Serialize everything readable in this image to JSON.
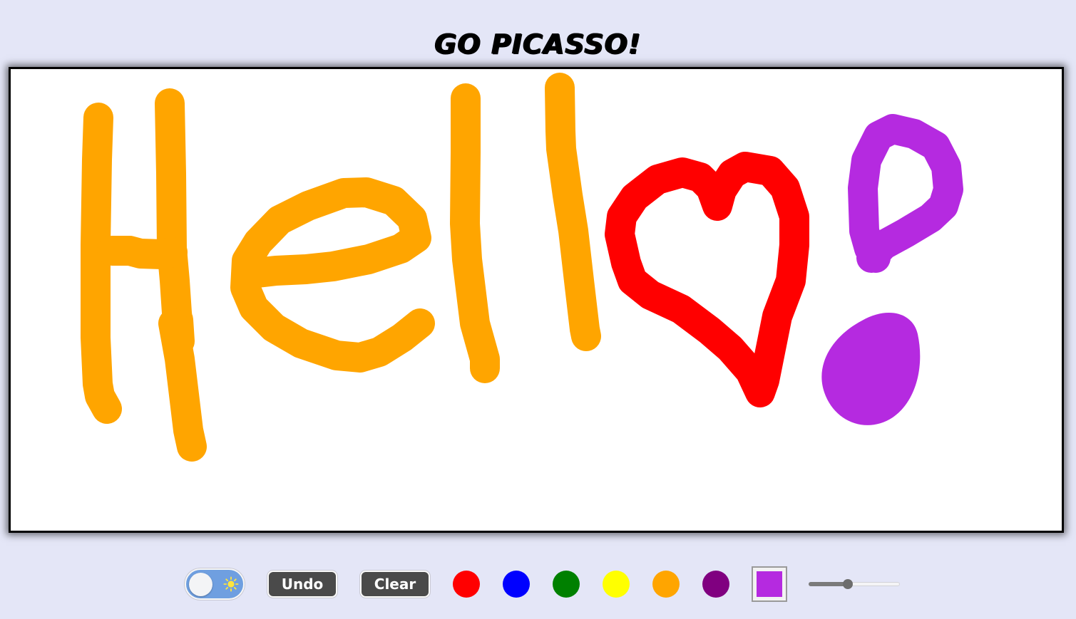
{
  "app": {
    "title": "GO PICASSO!"
  },
  "canvas": {
    "background": "#ffffff",
    "drawing_text": "Hello!",
    "strokes": [
      {
        "color": "#ffa500",
        "shape": "letter-H"
      },
      {
        "color": "#ffa500",
        "shape": "letter-e"
      },
      {
        "color": "#ffa500",
        "shape": "letter-l"
      },
      {
        "color": "#ffa500",
        "shape": "letter-l"
      },
      {
        "color": "#ff0000",
        "shape": "heart"
      },
      {
        "color": "#b52ae0",
        "shape": "exclamation-mark"
      }
    ]
  },
  "toolbar": {
    "theme_toggle": {
      "mode": "light",
      "icon": "sun-icon"
    },
    "undo_label": "Undo",
    "clear_label": "Clear",
    "palette": [
      {
        "name": "red",
        "color": "#ff0000"
      },
      {
        "name": "blue",
        "color": "#0000ff"
      },
      {
        "name": "green",
        "color": "#008000"
      },
      {
        "name": "yellow",
        "color": "#ffff00"
      },
      {
        "name": "orange",
        "color": "#ffa500"
      },
      {
        "name": "purple",
        "color": "#800080"
      }
    ],
    "current_color": "#b52ae0",
    "brush_size_fraction": 0.43
  }
}
